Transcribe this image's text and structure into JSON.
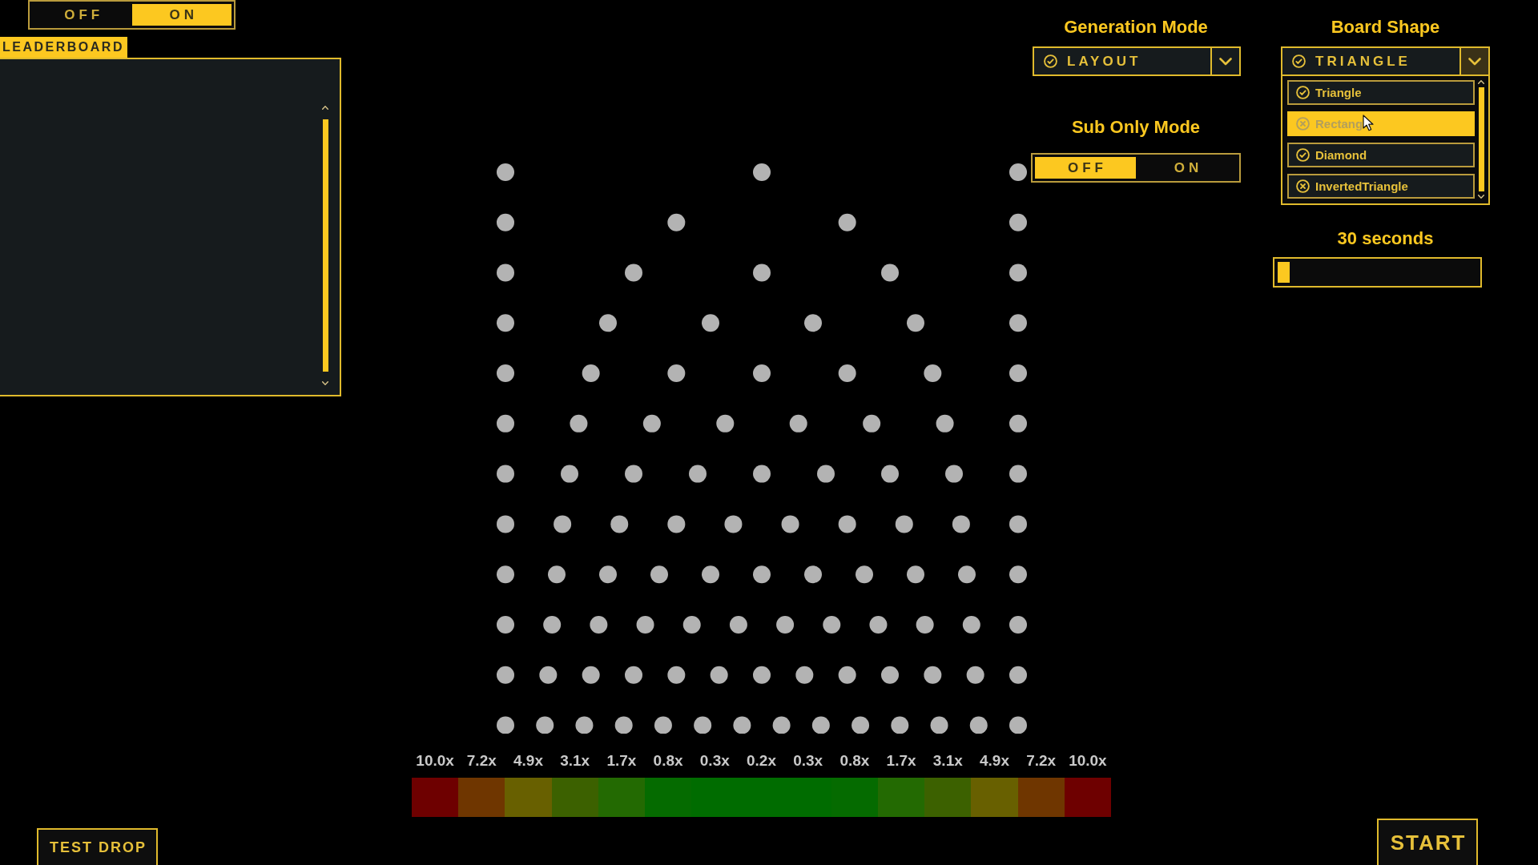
{
  "top_toggle": {
    "options": [
      {
        "label": "OFF",
        "selected": false
      },
      {
        "label": "ON",
        "selected": true
      }
    ]
  },
  "leaderboard": {
    "title": "LEADERBOARD"
  },
  "generation_mode": {
    "title": "Generation Mode",
    "value": "LAYOUT",
    "expanded": false
  },
  "board_shape": {
    "title": "Board Shape",
    "value": "TRIANGLE",
    "expanded": true,
    "options": [
      {
        "label": "Triangle",
        "available": true,
        "highlighted": false
      },
      {
        "label": "Rectang",
        "available": false,
        "highlighted": true
      },
      {
        "label": "Diamond",
        "available": true,
        "highlighted": false
      },
      {
        "label": "InvertedTriangle",
        "available": false,
        "highlighted": false
      }
    ]
  },
  "sub_only_mode": {
    "title": "Sub Only Mode",
    "options": [
      {
        "label": "OFF",
        "selected": true
      },
      {
        "label": "ON",
        "selected": false
      }
    ]
  },
  "timer": {
    "label": "30 seconds",
    "level": 0.06
  },
  "multipliers": [
    {
      "label": "10.0x",
      "color": "#6e0000"
    },
    {
      "label": "7.2x",
      "color": "#6f3600"
    },
    {
      "label": "4.9x",
      "color": "#686000"
    },
    {
      "label": "3.1x",
      "color": "#3c6100"
    },
    {
      "label": "1.7x",
      "color": "#236a02"
    },
    {
      "label": "0.8x",
      "color": "#056b00"
    },
    {
      "label": "0.3x",
      "color": "#006c00"
    },
    {
      "label": "0.2x",
      "color": "#006c00"
    },
    {
      "label": "0.3x",
      "color": "#006c00"
    },
    {
      "label": "0.8x",
      "color": "#056b00"
    },
    {
      "label": "1.7x",
      "color": "#236a02"
    },
    {
      "label": "3.1x",
      "color": "#3c6100"
    },
    {
      "label": "4.9x",
      "color": "#686000"
    },
    {
      "label": "7.2x",
      "color": "#6f3600"
    },
    {
      "label": "10.0x",
      "color": "#6e0000"
    }
  ],
  "test_drop_button": "TEST DROP",
  "start_button": "START"
}
